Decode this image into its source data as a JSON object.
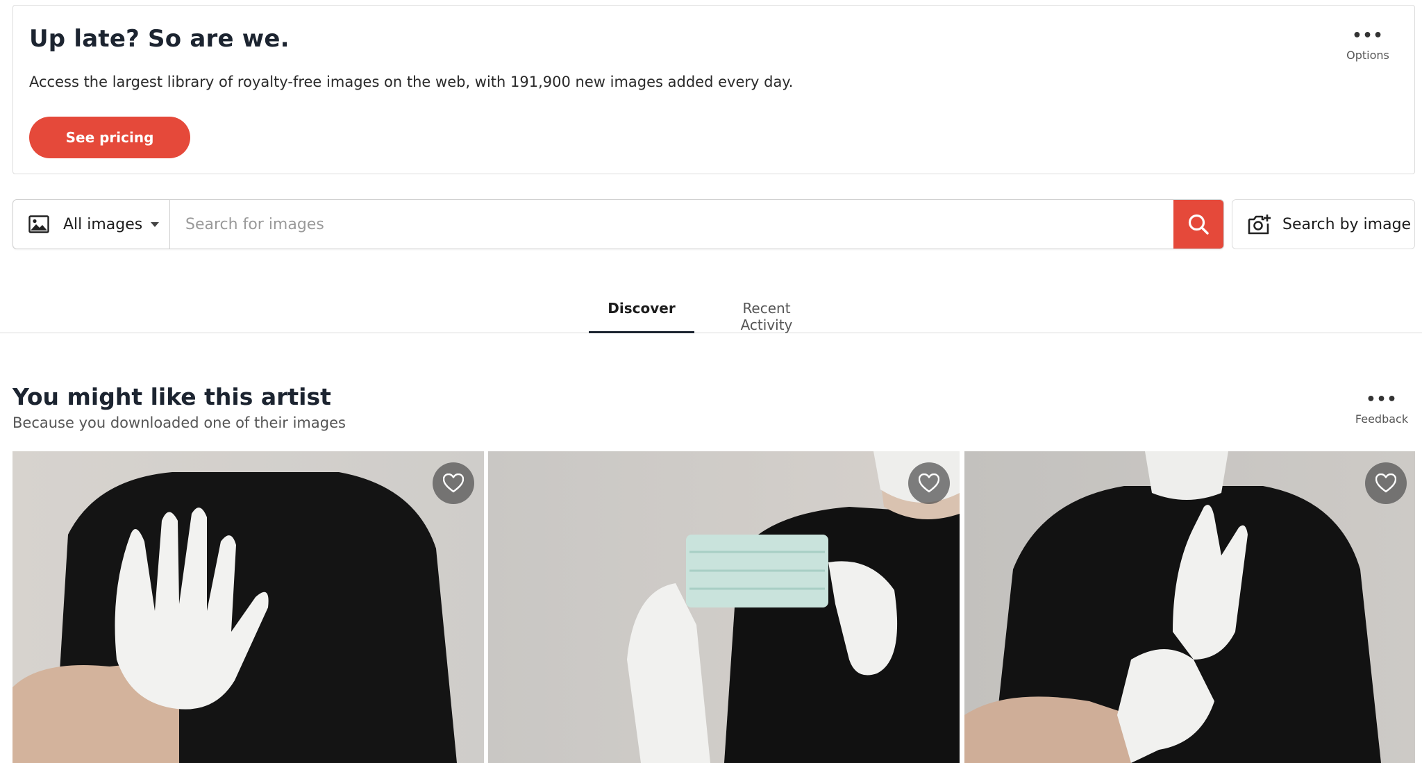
{
  "promo": {
    "title": "Up late? So are we.",
    "text": "Access the largest library of royalty-free images on the web, with 191,900 new images added every day.",
    "button_label": "See pricing",
    "options_label": "Options"
  },
  "search": {
    "type_label": "All images",
    "placeholder": "Search for images",
    "image_search_label": "Search by image"
  },
  "tabs": [
    {
      "label": "Discover",
      "active": true
    },
    {
      "label": "Recent Activity",
      "active": false
    }
  ],
  "section": {
    "title": "You might like this artist",
    "subtitle": "Because you downloaded one of their images",
    "feedback_label": "Feedback"
  },
  "colors": {
    "accent": "#e5493a",
    "heading": "#1c2430"
  },
  "icons": {
    "options": "more-dots-icon",
    "type": "image-icon",
    "search": "search-icon",
    "image_search": "camera-plus-icon",
    "favorite": "heart-icon"
  }
}
